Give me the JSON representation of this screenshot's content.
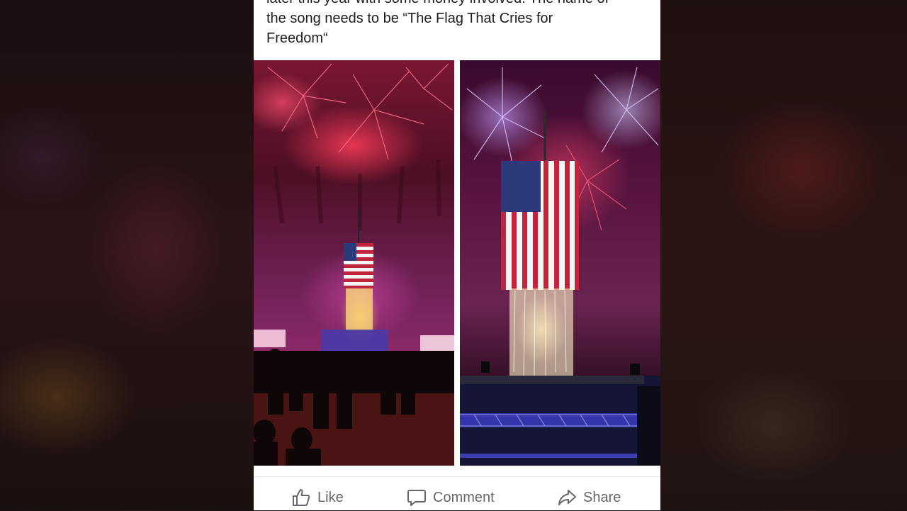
{
  "post": {
    "text_lines": [
      "later this year with some money involved. The name of",
      "the song needs to be “The Flag That Cries for",
      "Freedom“"
    ]
  },
  "photos": [
    {
      "icon": "fireworks-flag-crowd-photo"
    },
    {
      "icon": "fireworks-flag-stage-photo"
    }
  ],
  "actions": {
    "like_label": "Like",
    "comment_label": "Comment",
    "share_label": "Share"
  },
  "colors": {
    "text": "#1c1e21",
    "action_text": "#65676b",
    "divider": "#e4e6eb"
  }
}
